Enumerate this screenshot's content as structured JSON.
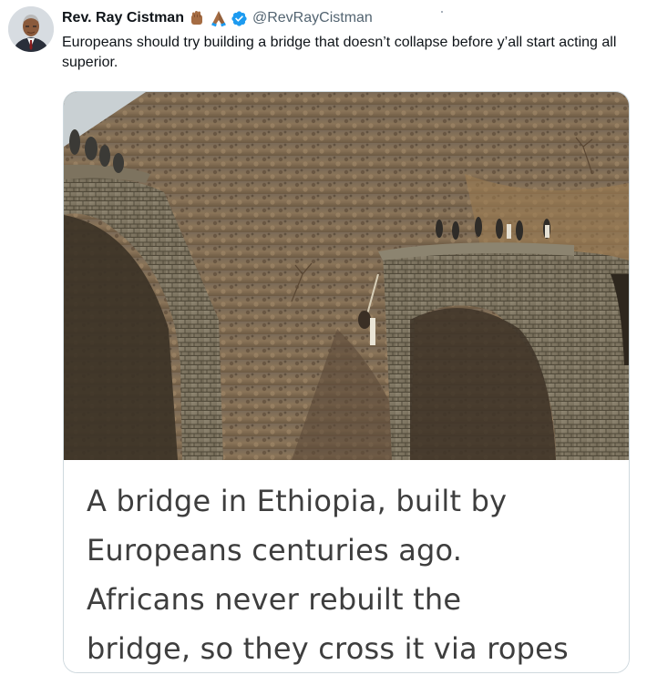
{
  "author": {
    "display_name": "Rev. Ray Cistman",
    "handle": "@RevRayCistman",
    "emojis": [
      "raised-fist-icon",
      "folded-hands-icon"
    ],
    "verified": true
  },
  "tweet": {
    "text": "Europeans should try building a bridge that doesn’t collapse before y’all start acting all superior."
  },
  "media": {
    "caption_lines": [
      "A bridge in Ethiopia, built by",
      "Europeans centuries ago.",
      "Africans never rebuilt the",
      "bridge, so they cross it via ropes"
    ]
  },
  "colors": {
    "verified_blue": "#1d9bf0",
    "handle_gray": "#536471",
    "border": "#cfd9de"
  }
}
